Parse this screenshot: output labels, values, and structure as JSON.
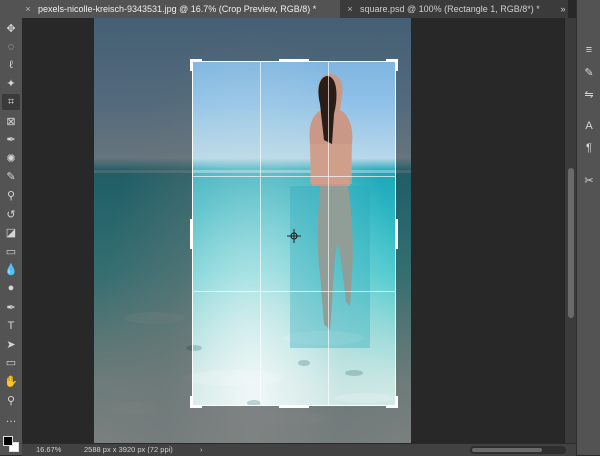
{
  "tabs": [
    {
      "label": "pexels-nicolle-kreisch-9343531.jpg @ 16.7% (Crop Preview, RGB/8) *",
      "active": true
    },
    {
      "label": "square.psd @ 100% (Rectangle 1, RGB/8*) *",
      "active": false
    }
  ],
  "tab_close_glyph": "×",
  "overflow_glyph": "»",
  "tools": [
    {
      "name": "move-tool-icon",
      "glyph": "✥"
    },
    {
      "name": "marquee-tool-icon",
      "glyph": "◌"
    },
    {
      "name": "lasso-tool-icon",
      "glyph": "ℓ"
    },
    {
      "name": "magic-wand-tool-icon",
      "glyph": "✦"
    },
    {
      "name": "crop-tool-icon",
      "glyph": "⌗",
      "active": true
    },
    {
      "name": "frame-tool-icon",
      "glyph": "⊠"
    },
    {
      "name": "eyedropper-tool-icon",
      "glyph": "✒"
    },
    {
      "name": "healing-brush-tool-icon",
      "glyph": "✺"
    },
    {
      "name": "brush-tool-icon",
      "glyph": "✎"
    },
    {
      "name": "clone-stamp-tool-icon",
      "glyph": "⚲"
    },
    {
      "name": "history-brush-tool-icon",
      "glyph": "↺"
    },
    {
      "name": "eraser-tool-icon",
      "glyph": "◪"
    },
    {
      "name": "gradient-tool-icon",
      "glyph": "▭"
    },
    {
      "name": "blur-tool-icon",
      "glyph": "💧"
    },
    {
      "name": "dodge-tool-icon",
      "glyph": "●"
    },
    {
      "name": "pen-tool-icon",
      "glyph": "✒"
    },
    {
      "name": "type-tool-icon",
      "glyph": "T"
    },
    {
      "name": "path-selection-tool-icon",
      "glyph": "➤"
    },
    {
      "name": "rectangle-tool-icon",
      "glyph": "▭"
    },
    {
      "name": "hand-tool-icon",
      "glyph": "✋"
    },
    {
      "name": "zoom-tool-icon",
      "glyph": "⚲"
    },
    {
      "name": "more-tools-icon",
      "glyph": "…"
    }
  ],
  "panel_icons": [
    {
      "name": "adjustments-panel-icon",
      "glyph": "≡"
    },
    {
      "name": "brush-settings-panel-icon",
      "glyph": "✎"
    },
    {
      "name": "tool-presets-panel-icon",
      "glyph": "⇋"
    },
    {
      "name": "character-panel-icon",
      "glyph": "A"
    },
    {
      "name": "paragraph-panel-icon",
      "glyph": "¶"
    },
    {
      "name": "tools-panel-icon",
      "glyph": "✂"
    }
  ],
  "status": {
    "zoom": "16.67%",
    "doc_size": "2588 px x 3920 px (72 ppi)",
    "arrow": "›"
  },
  "colors": {
    "foreground": "#000000",
    "background": "#ffffff"
  }
}
